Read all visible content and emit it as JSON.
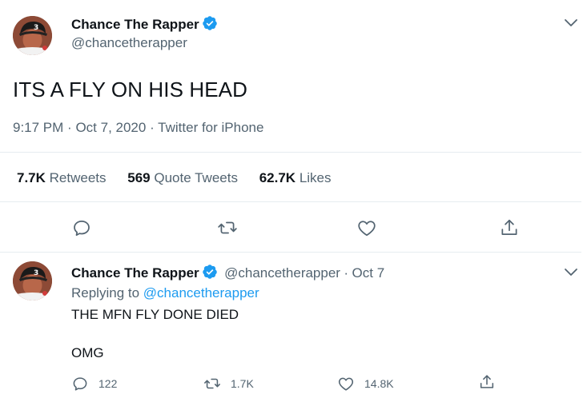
{
  "main_tweet": {
    "author_name": "Chance The Rapper",
    "author_handle": "@chancetherapper",
    "text": "ITS A FLY ON HIS HEAD",
    "time": "9:17 PM",
    "date": "Oct 7, 2020",
    "source": "Twitter for iPhone",
    "separator": "·",
    "stats": {
      "retweets_count": "7.7K",
      "retweets_label": "Retweets",
      "quotes_count": "569",
      "quotes_label": "Quote Tweets",
      "likes_count": "62.7K",
      "likes_label": "Likes"
    }
  },
  "reply_tweet": {
    "author_name": "Chance The Rapper",
    "author_handle": "@chancetherapper",
    "date": "Oct 7",
    "separator": "·",
    "replying_label": "Replying to",
    "replying_handle": "@chancetherapper",
    "line1": "THE MFN FLY DONE DIED",
    "line2": "OMG",
    "counts": {
      "replies": "122",
      "retweets": "1.7K",
      "likes": "14.8K"
    }
  },
  "icons": {
    "verified": "verified-badge-icon",
    "chevron": "chevron-down-icon",
    "reply": "reply-icon",
    "retweet": "retweet-icon",
    "like": "heart-icon",
    "share": "share-icon"
  },
  "colors": {
    "accent": "#1d9bf0",
    "muted": "#536471",
    "text": "#0f1419",
    "divider": "#e6ecf0"
  }
}
